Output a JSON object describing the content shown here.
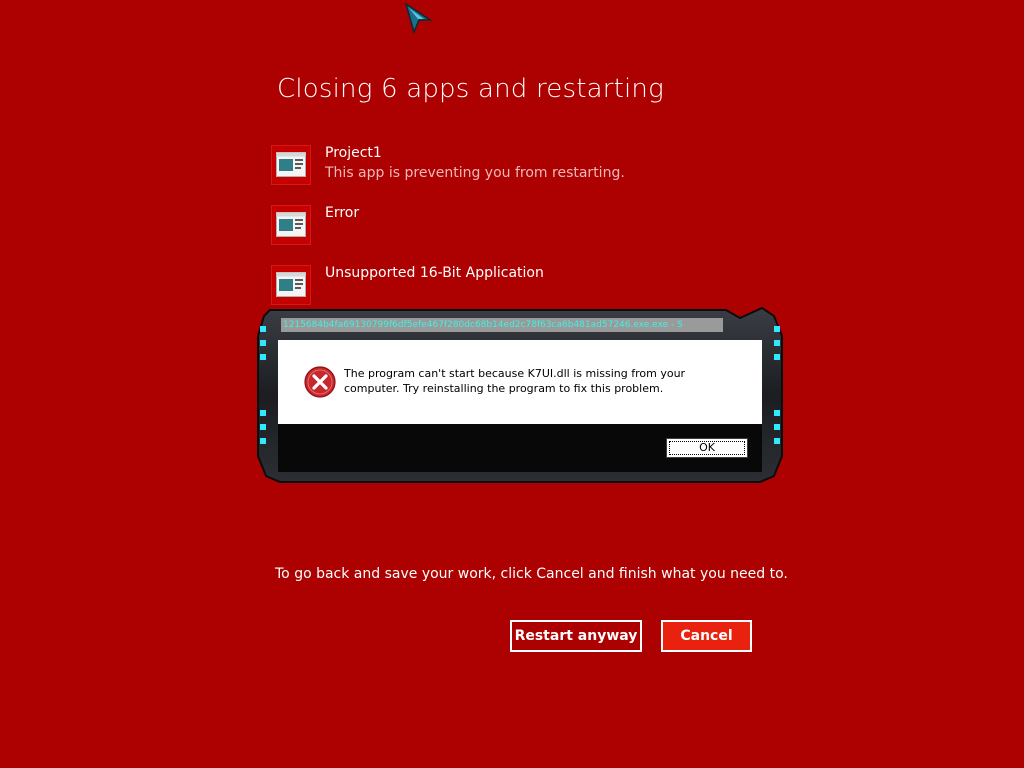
{
  "header": {
    "title": "Closing 6 apps and restarting"
  },
  "apps": [
    {
      "name": "Project1",
      "status": "This app is preventing you from restarting."
    },
    {
      "name": "Error",
      "status": ""
    },
    {
      "name": "Unsupported 16-Bit Application",
      "status": ""
    }
  ],
  "dialog": {
    "title": "1215684b4fa69130799f6df5efe467f280dc68b14ed2c78f63ca6b481ad57246.exe.exe - S",
    "message": "The program can't start because K7UI.dll is missing from your computer. Try reinstalling the program to fix this problem.",
    "ok_label": "OK",
    "icon": "error-icon"
  },
  "footer": {
    "hint": "To go back and save your work, click Cancel and finish what you need to.",
    "restart_label": "Restart anyway",
    "cancel_label": "Cancel"
  },
  "colors": {
    "background": "#ad0000",
    "cancel_button": "#e8220f",
    "dialog_title_text": "#40f0e0"
  }
}
